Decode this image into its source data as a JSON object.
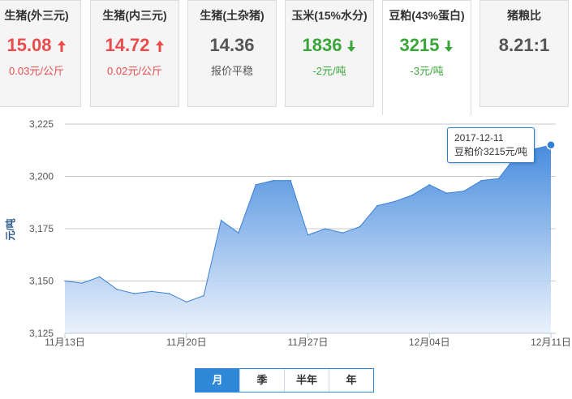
{
  "cards": [
    {
      "name": "生猪(外三元)",
      "price": "15.08",
      "change": "0.03元/公斤",
      "direction": "up"
    },
    {
      "name": "生猪(内三元)",
      "price": "14.72",
      "change": "0.02元/公斤",
      "direction": "up"
    },
    {
      "name": "生猪(土杂猪)",
      "price": "14.36",
      "change": "报价平稳",
      "direction": "flat"
    },
    {
      "name": "玉米(15%水分)",
      "price": "1836",
      "change": "-2元/吨",
      "direction": "down"
    },
    {
      "name": "豆粕(43%蛋白)",
      "price": "3215",
      "change": "-3元/吨",
      "direction": "down"
    },
    {
      "name": "猪粮比",
      "price": "8.21:1",
      "change": "",
      "direction": "none"
    }
  ],
  "active_card": 4,
  "colors": {
    "up": "#e84c4c",
    "down": "#3aa63a",
    "accent": "#2f87d8",
    "area_top": "#3d86dc",
    "area_bottom": "#e8f0fb"
  },
  "tabs": [
    "月",
    "季",
    "半年",
    "年"
  ],
  "active_tab": 0,
  "tooltip": {
    "date": "2017-12-11",
    "text": "豆粕价3215元/吨"
  },
  "chart_data": {
    "type": "area",
    "ylabel": "元/吨",
    "ylim": [
      3125,
      3225
    ],
    "yticks": [
      3125,
      3150,
      3175,
      3200,
      3225
    ],
    "ytick_labels": [
      "3,125",
      "3,150",
      "3,175",
      "3,200",
      "3,225"
    ],
    "xtick_labels": [
      "11月13日",
      "11月20日",
      "11月27日",
      "12月04日",
      "12月11日"
    ],
    "x": [
      "2017-11-13",
      "2017-11-14",
      "2017-11-15",
      "2017-11-16",
      "2017-11-17",
      "2017-11-18",
      "2017-11-19",
      "2017-11-20",
      "2017-11-21",
      "2017-11-22",
      "2017-11-23",
      "2017-11-24",
      "2017-11-25",
      "2017-11-26",
      "2017-11-27",
      "2017-11-28",
      "2017-11-29",
      "2017-11-30",
      "2017-12-01",
      "2017-12-02",
      "2017-12-03",
      "2017-12-04",
      "2017-12-05",
      "2017-12-06",
      "2017-12-07",
      "2017-12-08",
      "2017-12-09",
      "2017-12-10",
      "2017-12-11"
    ],
    "values": [
      3150,
      3149,
      3152,
      3146,
      3144,
      3145,
      3144,
      3140,
      3143,
      3179,
      3173,
      3196,
      3198,
      3198,
      3172,
      3175,
      3173,
      3176,
      3186,
      3188,
      3191,
      3196,
      3192,
      3193,
      3198,
      3199,
      3210,
      3213,
      3215
    ],
    "grid": true
  }
}
